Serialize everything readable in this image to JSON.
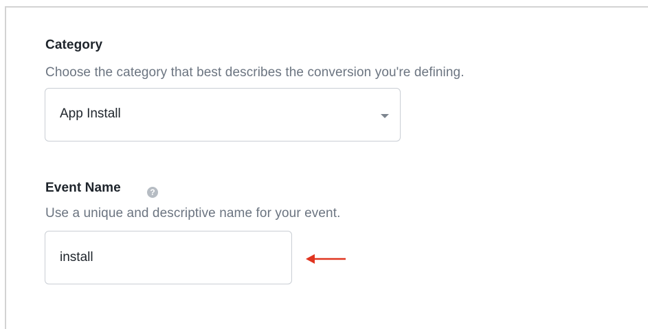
{
  "category": {
    "label": "Category",
    "description": "Choose the category that best describes the conversion you're defining.",
    "selected_value": "App Install"
  },
  "event_name": {
    "label": "Event Name",
    "help_icon": "question-circle-icon",
    "description": "Use a unique and descriptive name for your event.",
    "value": "install"
  },
  "annotation": {
    "arrow_icon": "left-arrow-icon",
    "arrow_color": "#e0341f"
  },
  "colors": {
    "label_text": "#1e242b",
    "description_text": "#6b7480",
    "field_border": "#c9ced4"
  }
}
